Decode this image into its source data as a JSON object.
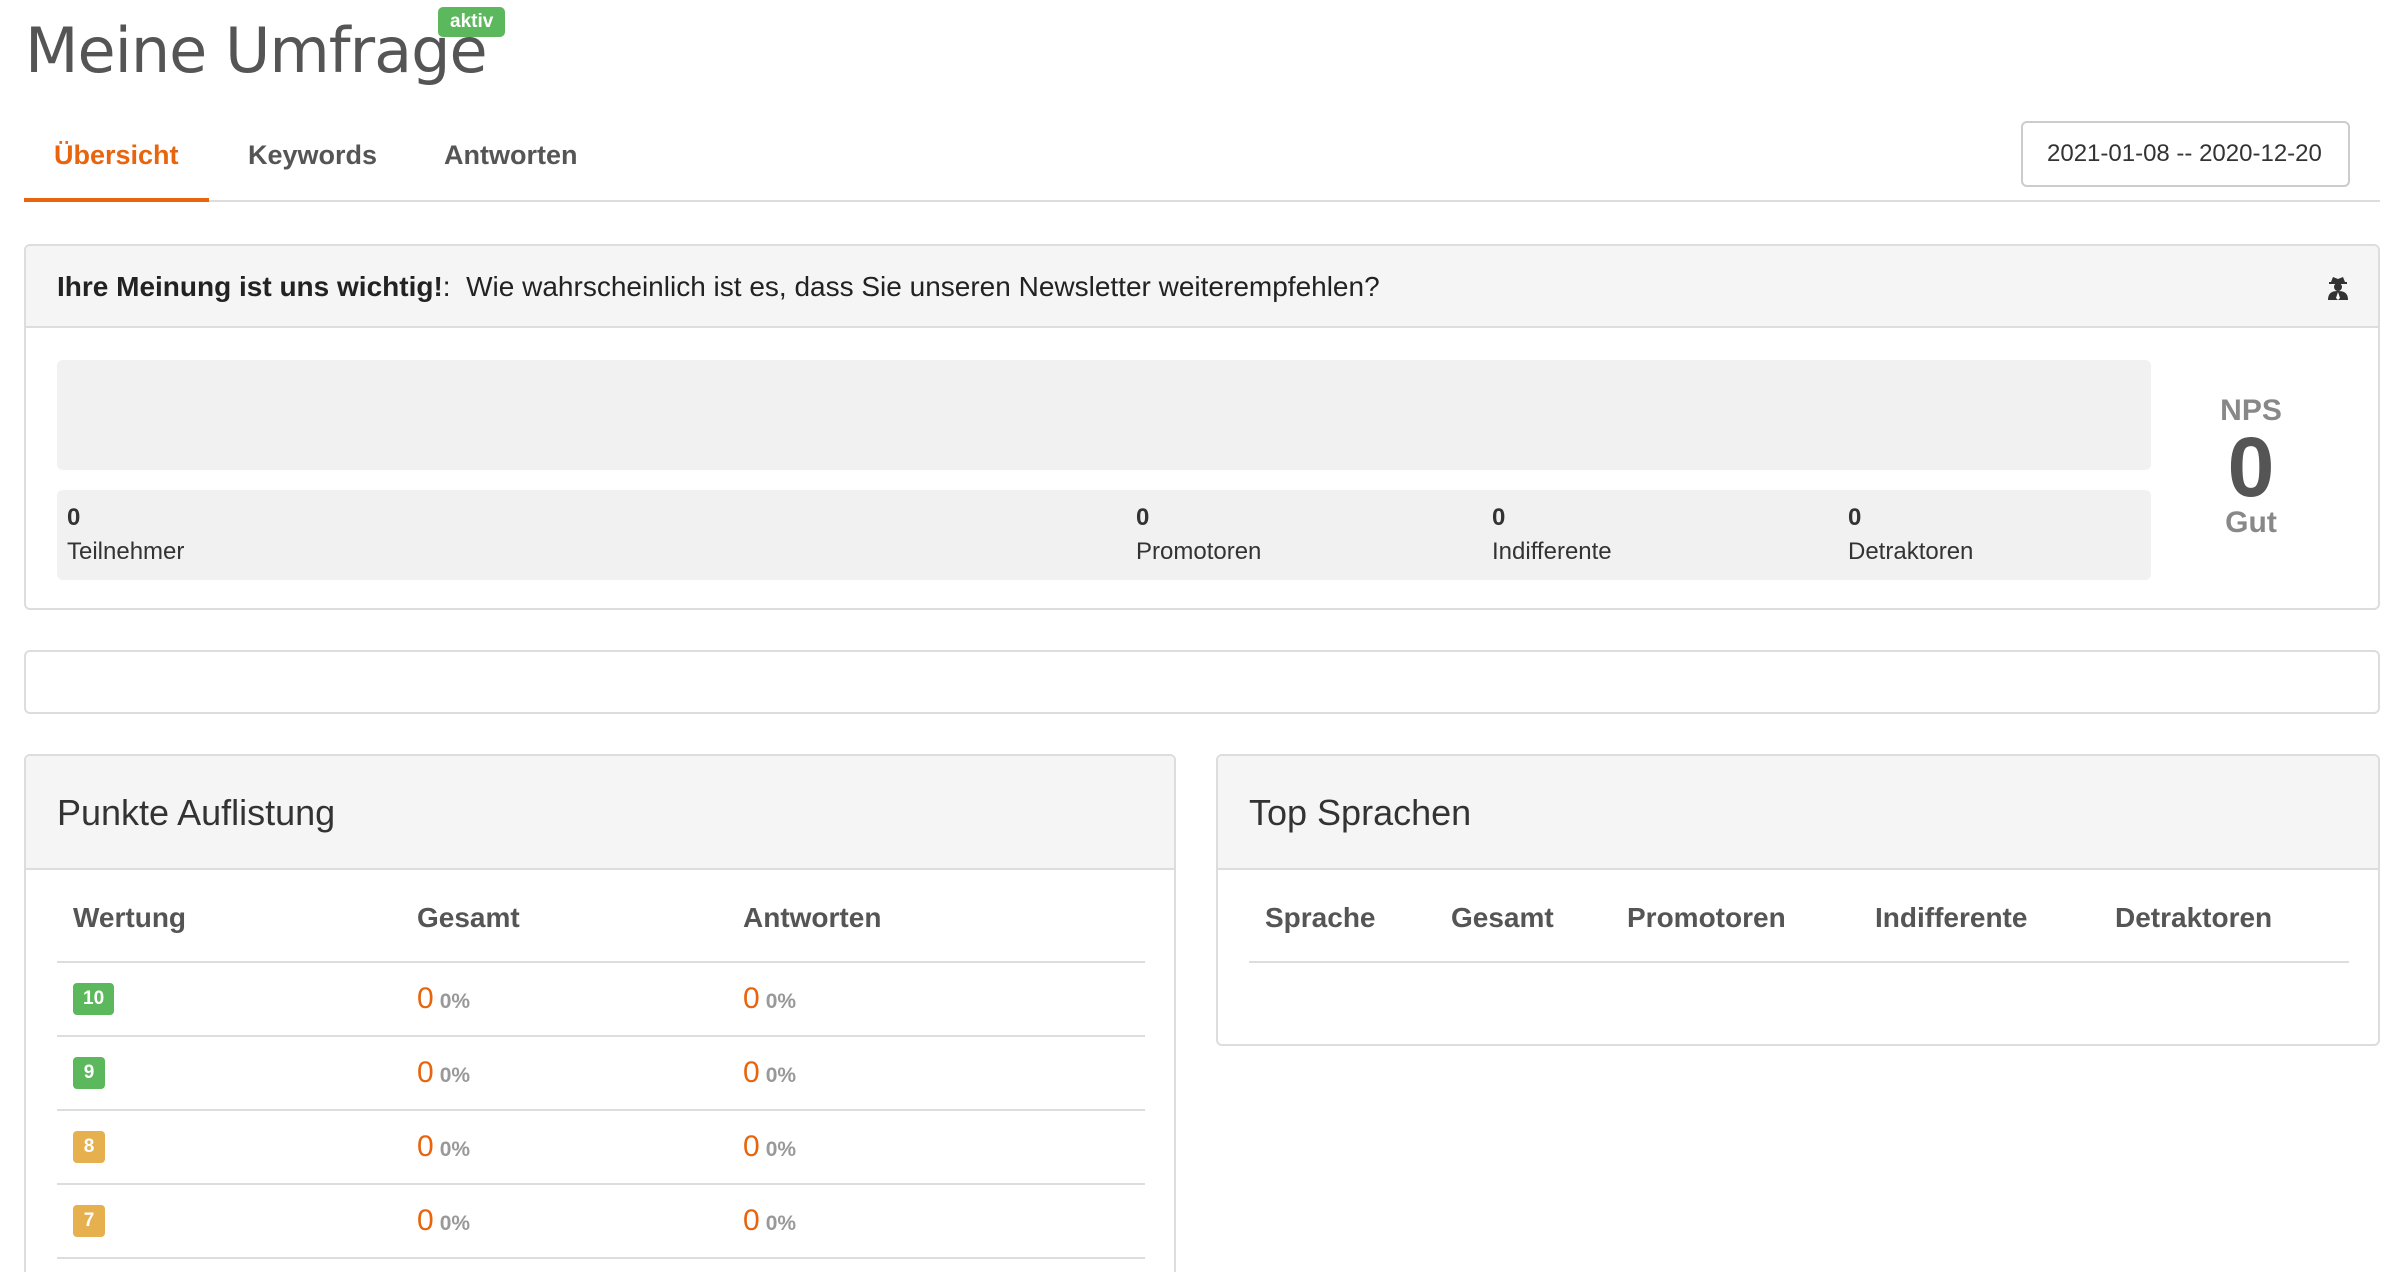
{
  "page": {
    "title": "Meine Umfrage",
    "status": "aktiv"
  },
  "tabs": [
    {
      "label": "Übersicht",
      "active": true
    },
    {
      "label": "Keywords",
      "active": false
    },
    {
      "label": "Antworten",
      "active": false
    }
  ],
  "date_range": {
    "value": "2021-01-08 -- 2020-12-20"
  },
  "question": {
    "title": "Ihre Meinung ist uns wichtig!",
    "separator": ":",
    "text": "Wie wahrscheinlich ist es, dass Sie unseren Newsletter weiterempfehlen?",
    "icon": "user-secret-icon"
  },
  "stats": [
    {
      "value": "0",
      "label": "Teilnehmer"
    },
    {
      "value": "0",
      "label": "Promotoren"
    },
    {
      "value": "0",
      "label": "Indifferente"
    },
    {
      "value": "0",
      "label": "Detraktoren"
    }
  ],
  "nps": {
    "label": "NPS",
    "value": "0",
    "rating": "Gut"
  },
  "score_list": {
    "title": "Punkte Auflistung",
    "headers": [
      "Wertung",
      "Gesamt",
      "Antworten"
    ],
    "rows": [
      {
        "score": "10",
        "color": "#5cb85c",
        "total": "0",
        "total_pct": "0%",
        "answers": "0",
        "answers_pct": "0%"
      },
      {
        "score": "9",
        "color": "#5cb85c",
        "total": "0",
        "total_pct": "0%",
        "answers": "0",
        "answers_pct": "0%"
      },
      {
        "score": "8",
        "color": "#e6b04f",
        "total": "0",
        "total_pct": "0%",
        "answers": "0",
        "answers_pct": "0%"
      },
      {
        "score": "7",
        "color": "#e6b04f",
        "total": "0",
        "total_pct": "0%",
        "answers": "0",
        "answers_pct": "0%"
      }
    ]
  },
  "top_languages": {
    "title": "Top Sprachen",
    "headers": [
      "Sprache",
      "Gesamt",
      "Promotoren",
      "Indifferente",
      "Detraktoren"
    ]
  },
  "colors": {
    "accent": "#e8650e",
    "success": "#5cb85c",
    "warning": "#e6b04f"
  }
}
